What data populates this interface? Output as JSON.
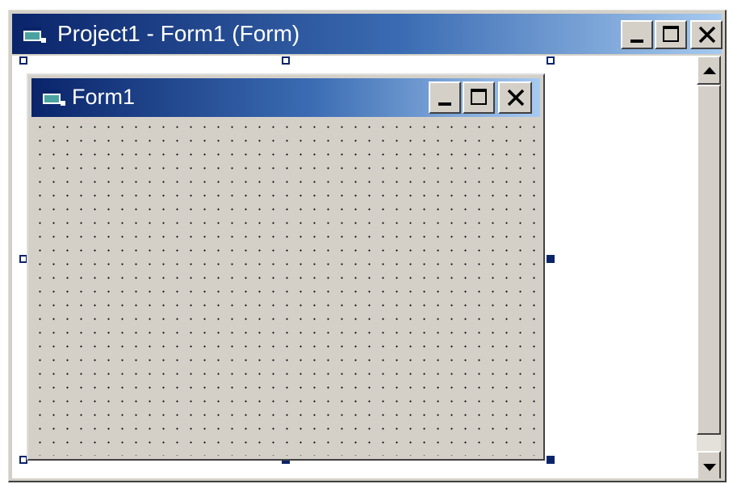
{
  "outer_window": {
    "title": "Project1 - Form1 (Form)",
    "icon": "form-icon",
    "controls": {
      "minimize": "minimize-icon",
      "maximize": "maximize-icon",
      "close": "close-icon"
    }
  },
  "form": {
    "title": "Form1",
    "icon": "form-icon",
    "controls": {
      "minimize": "minimize-icon",
      "maximize": "maximize-icon",
      "close": "close-icon"
    },
    "grid": "dotted"
  },
  "scrollbar": {
    "orientation": "vertical",
    "up_icon": "arrow-up-icon",
    "down_icon": "arrow-down-icon"
  },
  "colors": {
    "title_gradient_start": "#0a246a",
    "title_gradient_end": "#a6caf0",
    "face": "#d4d0c8",
    "handle": "#0a246a"
  }
}
